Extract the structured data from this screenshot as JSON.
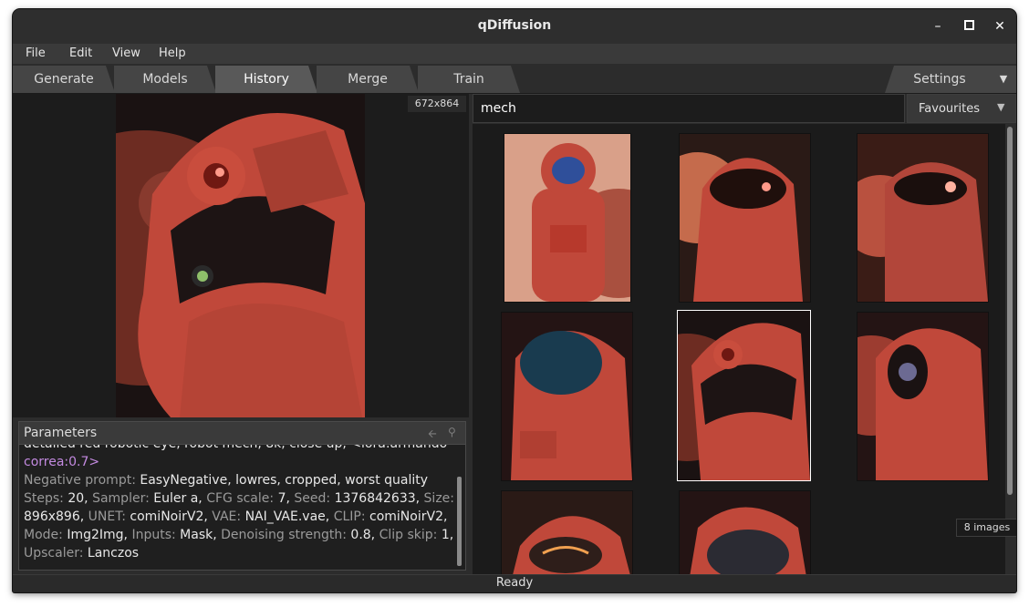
{
  "window": {
    "title": "qDiffusion"
  },
  "menu": [
    "File",
    "Edit",
    "View",
    "Help"
  ],
  "tabs": [
    "Generate",
    "Models",
    "History",
    "Merge",
    "Train"
  ],
  "active_tab": "History",
  "settings_tab": "Settings",
  "settings_menu_glyph": "▼",
  "preview": {
    "size_label": "672x864"
  },
  "parameters": {
    "title": "Parameters",
    "prompt_cut_line": "detailed red robotic eye, robot mech, 8k, close up, <lora:armando",
    "prompt_tail": "correa:0.7>",
    "negative_key": "Negative prompt",
    "negative_value": "EasyNegative, lowres, cropped, worst quality",
    "fields": [
      {
        "k": "Steps",
        "v": "20"
      },
      {
        "k": "Sampler",
        "v": "Euler a"
      },
      {
        "k": "CFG scale",
        "v": "7"
      },
      {
        "k": "Seed",
        "v": "1376842633"
      },
      {
        "k": "Size",
        "v": "896x896"
      },
      {
        "k": "UNET",
        "v": "comiNoirV2"
      },
      {
        "k": "VAE",
        "v": "NAI_VAE.vae"
      },
      {
        "k": "CLIP",
        "v": "comiNoirV2"
      },
      {
        "k": "Mode",
        "v": "Img2Img"
      },
      {
        "k": "Inputs",
        "v": "Mask"
      },
      {
        "k": "Denoising strength",
        "v": "0.8"
      },
      {
        "k": "Clip skip",
        "v": "1"
      },
      {
        "k": "Upscaler",
        "v": "Lanczos"
      }
    ]
  },
  "search": {
    "value": "mech"
  },
  "filter": {
    "selected": "Favourites"
  },
  "gallery": {
    "count_label": "8 images",
    "selected_index": 4
  },
  "status": {
    "text": "Ready"
  },
  "colors": {
    "accent_red": "#c0483a",
    "dark_bg": "#1b1b1b",
    "status_green": "#4c7a4c"
  }
}
